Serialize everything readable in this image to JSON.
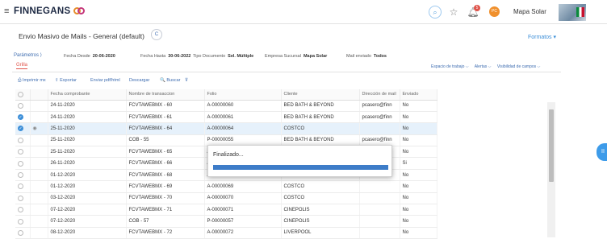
{
  "topbar": {
    "logo": "FINNEGANS",
    "company": "Mapa Solar",
    "avatar_initials": "PC",
    "notifications": "5",
    "icons": [
      "menu-icon",
      "search-icon",
      "star-icon",
      "bell-icon"
    ]
  },
  "page": {
    "title": "Envio Masivo de Mails - General (default)",
    "title_button": "C",
    "formatos": "Formatos ▾"
  },
  "params": {
    "link": "Parámetros ⟩",
    "fields": [
      {
        "label": "Fecha Desde",
        "value": "20-06-2020"
      },
      {
        "label": "Fecha Hasta",
        "value": "30-06-2022"
      },
      {
        "label": "Tipo Documento",
        "value": "Sel. Múltiple"
      },
      {
        "label": "Empresa Sucursal",
        "value": "Mapa Solar"
      },
      {
        "label": "Mail enviado",
        "value": "Todos"
      }
    ]
  },
  "tabs": {
    "grilla": "Grilla",
    "right": [
      "Espacio de trabajo ⌵",
      "Alertas ⌵",
      "Visibilidad de campos ⌵"
    ]
  },
  "toolbar": {
    "imprimir": "⎙ Imprimir mx",
    "exportar": "⇪ Exportar",
    "enviar": "Enviar pdf/html",
    "descargar": "Descargar",
    "buscar": "🔍 Buscar",
    "filter": "⊽"
  },
  "grid": {
    "columns": [
      "",
      "",
      "Fecha comprobante",
      "Nombre de transaccion",
      "Folio",
      "Cliente",
      "Dirección de mail",
      "Enviado"
    ],
    "rows": [
      {
        "checked": false,
        "hl": false,
        "eye": false,
        "fecha": "24-11-2020",
        "trans": "FCVTAWEBMX - 60",
        "folio": "A-00000060",
        "cliente": "BED BATH & BEYOND",
        "mail": "pcasero@finn",
        "enviado": "No"
      },
      {
        "checked": true,
        "hl": false,
        "eye": false,
        "fecha": "24-11-2020",
        "trans": "FCVTAWEBMX - 61",
        "folio": "A-00000061",
        "cliente": "BED BATH & BEYOND",
        "mail": "pcasero@finn",
        "enviado": "No"
      },
      {
        "checked": true,
        "hl": true,
        "eye": true,
        "fecha": "25-11-2020",
        "trans": "FCVTAWEBMX - 64",
        "folio": "A-00000064",
        "cliente": "COSTCO",
        "mail": "",
        "enviado": "No"
      },
      {
        "checked": false,
        "hl": false,
        "eye": false,
        "fecha": "25-11-2020",
        "trans": "COB - 55",
        "folio": "P-00000055",
        "cliente": "BED BATH & BEYOND",
        "mail": "pcasero@finn",
        "enviado": "No"
      },
      {
        "checked": false,
        "hl": false,
        "eye": false,
        "fecha": "25-11-2020",
        "trans": "FCVTAWEBMX - 65",
        "folio": "A-",
        "cliente": "",
        "mail": "",
        "enviado": "No"
      },
      {
        "checked": false,
        "hl": false,
        "eye": false,
        "fecha": "26-11-2020",
        "trans": "FCVTAWEBMX - 66",
        "folio": "A-",
        "cliente": "",
        "mail": "",
        "enviado": "Si"
      },
      {
        "checked": false,
        "hl": false,
        "eye": false,
        "fecha": "01-12-2020",
        "trans": "FCVTAWEBMX - 68",
        "folio": "A-",
        "cliente": "",
        "mail": "",
        "enviado": "No"
      },
      {
        "checked": false,
        "hl": false,
        "eye": false,
        "fecha": "01-12-2020",
        "trans": "FCVTAWEBMX - 69",
        "folio": "A-00000069",
        "cliente": "COSTCO",
        "mail": "",
        "enviado": "No"
      },
      {
        "checked": false,
        "hl": false,
        "eye": false,
        "fecha": "03-12-2020",
        "trans": "FCVTAWEBMX - 70",
        "folio": "A-00000070",
        "cliente": "COSTCO",
        "mail": "",
        "enviado": "No"
      },
      {
        "checked": false,
        "hl": false,
        "eye": false,
        "fecha": "07-12-2020",
        "trans": "FCVTAWEBMX - 71",
        "folio": "A-00000071",
        "cliente": "CINEPOLIS",
        "mail": "",
        "enviado": "No"
      },
      {
        "checked": false,
        "hl": false,
        "eye": false,
        "fecha": "07-12-2020",
        "trans": "COB - 57",
        "folio": "P-00000057",
        "cliente": "CINEPOLIS",
        "mail": "",
        "enviado": "No"
      },
      {
        "checked": false,
        "hl": false,
        "eye": false,
        "fecha": "08-12-2020",
        "trans": "FCVTAWEBMX - 72",
        "folio": "A-00000072",
        "cliente": "LIVERPOOL",
        "mail": "",
        "enviado": "No"
      }
    ]
  },
  "popup": {
    "label": "Finalizado...",
    "progress": 1.0
  },
  "side_button": "II"
}
